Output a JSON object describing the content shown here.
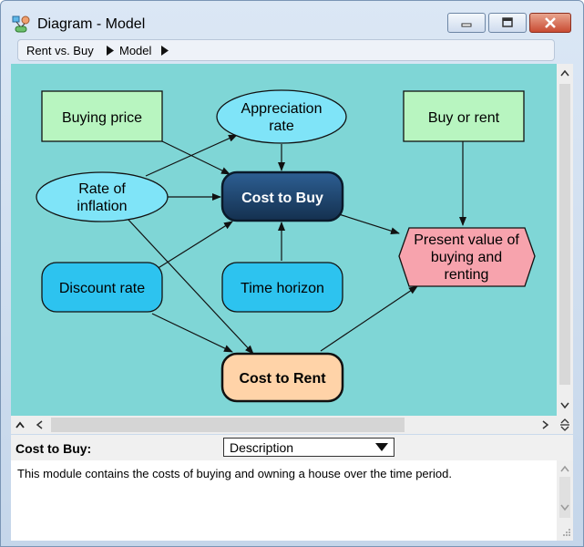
{
  "window": {
    "title": "Diagram - Model",
    "icon": "diagram-icon",
    "controls": [
      "minimize-icon",
      "maximize-icon",
      "close-icon"
    ],
    "close_color": "#c94c33"
  },
  "breadcrumb": {
    "items": [
      "Rent vs. Buy",
      "Model"
    ]
  },
  "diagram": {
    "background": "#7fd6d6",
    "nodes": {
      "buying_price": {
        "label": "Buying price",
        "type": "decision",
        "color": "#b8f5c0"
      },
      "appreciation_rate": {
        "label_lines": [
          "Appreciation",
          "rate"
        ],
        "type": "chance",
        "color": "#7fe4f8"
      },
      "buy_or_rent": {
        "label": "Buy or rent",
        "type": "decision",
        "color": "#b8f5c0"
      },
      "rate_of_inflation": {
        "label_lines": [
          "Rate of",
          "inflation"
        ],
        "type": "chance",
        "color": "#7fe4f8"
      },
      "cost_to_buy": {
        "label": "Cost to Buy",
        "type": "module",
        "color": "#1d3f66"
      },
      "present_value": {
        "label_lines": [
          "Present value of",
          "buying and",
          "renting"
        ],
        "type": "objective",
        "color": "#f7a3ad"
      },
      "discount_rate": {
        "label": "Discount rate",
        "type": "constant",
        "color": "#2dc3ef"
      },
      "time_horizon": {
        "label": "Time horizon",
        "type": "constant",
        "color": "#2dc3ef"
      },
      "cost_to_rent": {
        "label": "Cost to Rent",
        "type": "module",
        "color": "#ffd3a8"
      }
    }
  },
  "attribute_panel": {
    "node_label": "Cost to Buy:",
    "selected_attribute": "Description",
    "description_text": "This module contains the costs of buying and owning a house over the time period."
  }
}
